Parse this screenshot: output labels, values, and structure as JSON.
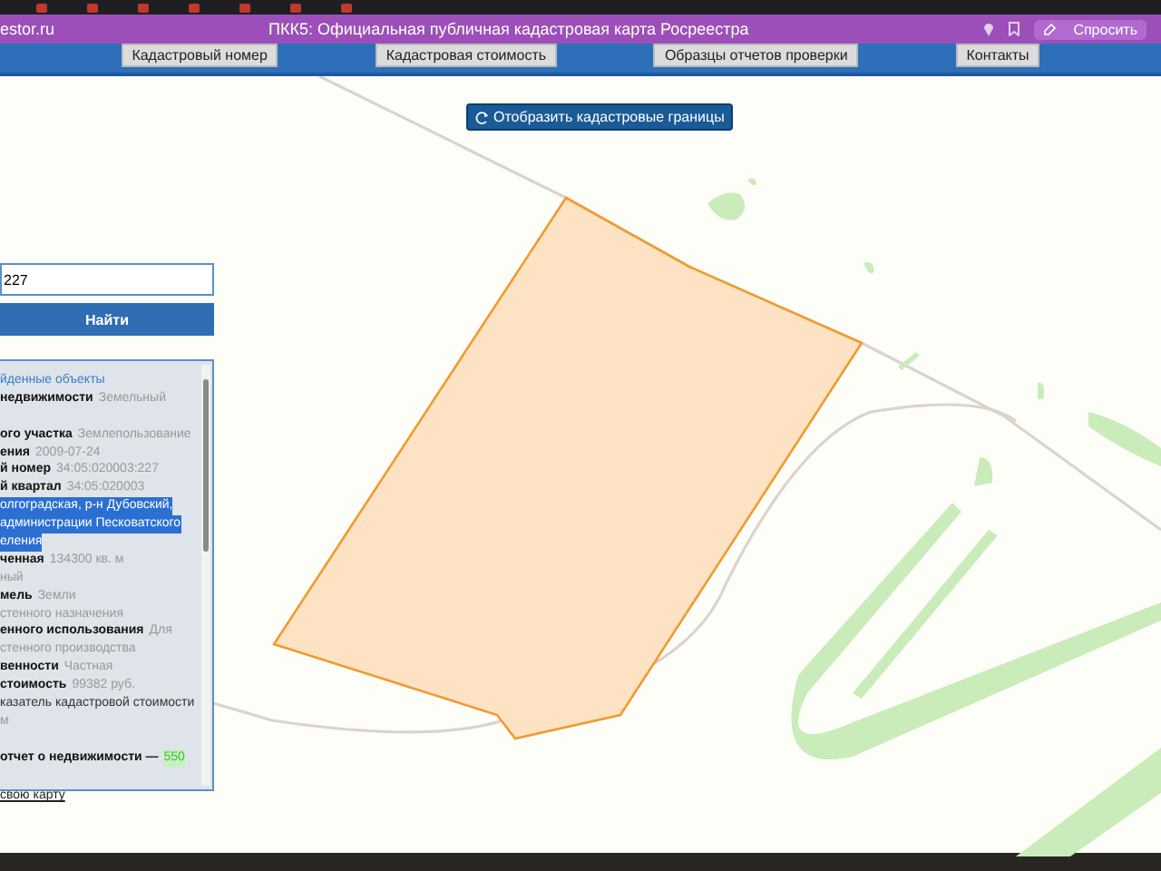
{
  "browser": {
    "site": "estor.ru",
    "title": "ПКК5: Официальная публичная кадастровая карта Росреестра",
    "ask_button": "Спросить"
  },
  "nav": {
    "links": [
      "Кадастровый номер",
      "Кадастровая стоимость",
      "Образцы отчетов проверки",
      "Контакты"
    ]
  },
  "map": {
    "toggle_button": "Отобразить кадастровые границы"
  },
  "search": {
    "value": "227",
    "button": "Найти"
  },
  "results": {
    "lines": [
      {
        "kind": "header",
        "value": "йденные объекты"
      },
      {
        "kind": "field",
        "label": "недвижимости",
        "value": "Земельный"
      },
      {
        "kind": "spacer"
      },
      {
        "kind": "field",
        "label": "ого участка",
        "value": "Землепользование"
      },
      {
        "kind": "field",
        "label": "ения",
        "value": "2009-07-24"
      },
      {
        "kind": "field",
        "label": "й номер",
        "value": "34:05:020003:227"
      },
      {
        "kind": "field",
        "label": "й квартал",
        "value": "34:05:020003"
      },
      {
        "kind": "text",
        "value": "олгоградская, р-н Дубовский,",
        "highlighted": true
      },
      {
        "kind": "text",
        "value": "администрации Песковатского",
        "highlighted": true
      },
      {
        "kind": "text",
        "value": "еления",
        "highlighted": true
      },
      {
        "kind": "field",
        "label": "ченная",
        "value": "134300 кв. м"
      },
      {
        "kind": "field",
        "value": "ный"
      },
      {
        "kind": "field",
        "label": "мель",
        "value": "Земли"
      },
      {
        "kind": "field",
        "value": "стенного назначения"
      },
      {
        "kind": "field",
        "label": "енного использования",
        "value": "Для"
      },
      {
        "kind": "field",
        "value": "стенного производства"
      },
      {
        "kind": "field",
        "label": "венности",
        "value": "Частная"
      },
      {
        "kind": "field",
        "label": "стоимость",
        "value": "99382 руб."
      },
      {
        "kind": "text",
        "value": "казатель кадастровой стоимости",
        "highlighted": false
      },
      {
        "kind": "field",
        "value": "м"
      },
      {
        "kind": "spacer"
      },
      {
        "kind": "price",
        "label": "отчет о недвижимости —",
        "value": "550"
      }
    ]
  },
  "footer_link": "свою карту"
}
